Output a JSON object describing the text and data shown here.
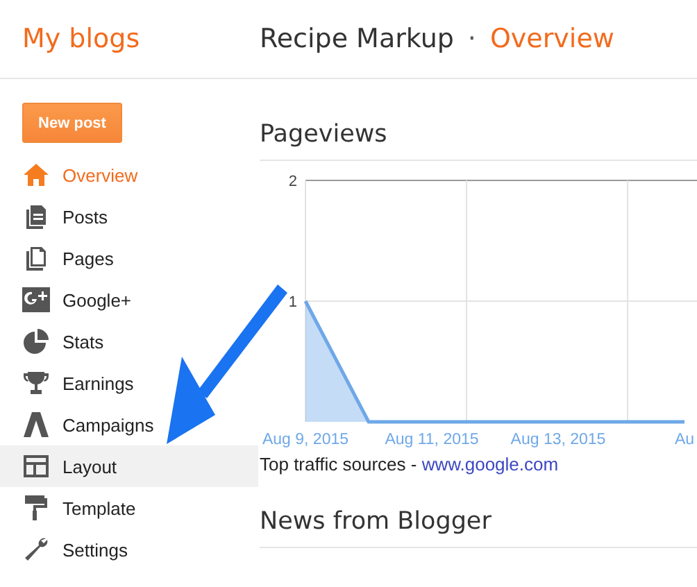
{
  "header": {
    "brand": "My blogs",
    "blog_title": "Recipe Markup",
    "separator": "·",
    "page": "Overview"
  },
  "new_post_button": "New post",
  "sidebar": {
    "items": [
      {
        "label": "Overview",
        "selected": true,
        "hovered": false
      },
      {
        "label": "Posts",
        "selected": false,
        "hovered": false
      },
      {
        "label": "Pages",
        "selected": false,
        "hovered": false
      },
      {
        "label": "Google+",
        "selected": false,
        "hovered": false
      },
      {
        "label": "Stats",
        "selected": false,
        "hovered": false
      },
      {
        "label": "Earnings",
        "selected": false,
        "hovered": false
      },
      {
        "label": "Campaigns",
        "selected": false,
        "hovered": false
      },
      {
        "label": "Layout",
        "selected": false,
        "hovered": true
      },
      {
        "label": "Template",
        "selected": false,
        "hovered": false
      },
      {
        "label": "Settings",
        "selected": false,
        "hovered": false
      }
    ]
  },
  "pageviews": {
    "title": "Pageviews",
    "chart_data": {
      "type": "area",
      "categories": [
        "Aug 9, 2015",
        null,
        "Aug 11, 2015",
        null,
        "Aug 13, 2015",
        null,
        "Au"
      ],
      "series": [
        {
          "color": "#6fa8e8",
          "values": [
            1,
            0,
            0,
            0,
            0,
            0,
            0
          ]
        }
      ],
      "ylim": [
        0,
        2
      ],
      "yticks": [
        1,
        2
      ]
    },
    "traffic_label": "Top traffic sources - ",
    "traffic_link": "www.google.com"
  },
  "news": {
    "title": "News from Blogger"
  }
}
